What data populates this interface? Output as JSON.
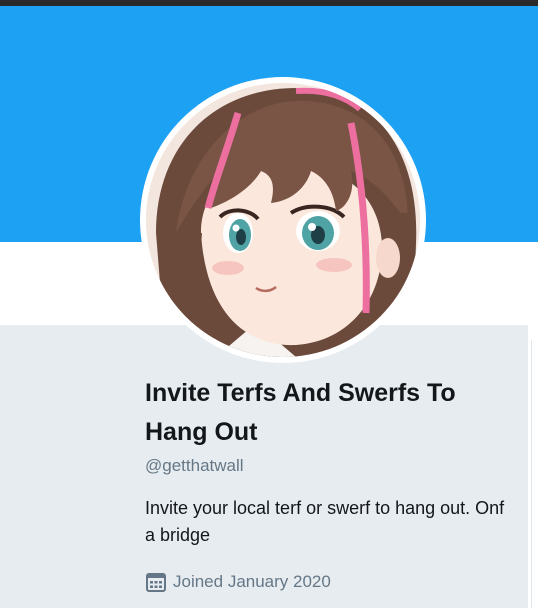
{
  "profile": {
    "display_name": "Invite Terfs And Swerfs To Hang Out",
    "handle": "@getthatwall",
    "bio": "Invite your local terf or swerf to hang out. Onf a bridge",
    "joined": "Joined January 2020",
    "icons": {
      "joined": "calendar-icon",
      "avatar": "anime-girl-avatar"
    }
  },
  "colors": {
    "banner": "#1da1f2",
    "card_background": "#e6ecf0",
    "name_text": "#14171a",
    "secondary_text": "#657786"
  }
}
